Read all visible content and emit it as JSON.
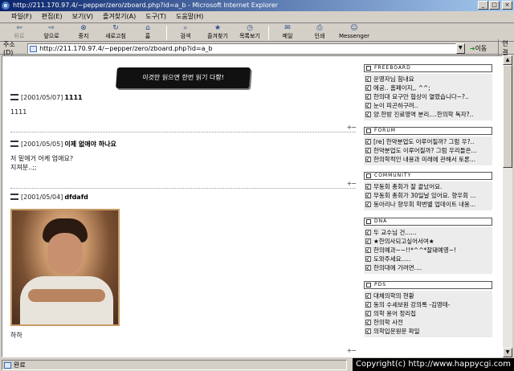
{
  "window": {
    "title": "http://211.170.97.4/~pepper/zero/zboard.php?id=a_b - Microsoft Internet Explorer"
  },
  "menu": [
    "파일(F)",
    "편집(E)",
    "보기(V)",
    "즐겨찾기(A)",
    "도구(T)",
    "도움말(H)"
  ],
  "toolbar": {
    "back": "뒤로",
    "forward": "앞으로",
    "stop": "중지",
    "refresh": "새로고침",
    "home": "홈",
    "search": "검색",
    "favorites": "즐겨찾기",
    "history": "목록보기",
    "mail": "메일",
    "print": "인쇄",
    "messenger": "Messenger"
  },
  "address": {
    "label": "주소(D)",
    "url": "http://211.170.97.4/~pepper/zero/zboard.php?id=a_b",
    "go": "이동",
    "links": "연결"
  },
  "page": {
    "banner": "이것만 읽으면 한번 읽기 다함!",
    "posts": [
      {
        "date": "[2001/05/07]",
        "title": "1111",
        "body": [
          "1111"
        ]
      },
      {
        "date": "[2001/05/05]",
        "title": "이제 없애야 하나요",
        "body": [
          "저 밑에거 어케 업애요?",
          "지져분..;;"
        ]
      },
      {
        "date": "[2001/05/04]",
        "title": "dfdafd",
        "body": [
          "하하"
        ]
      }
    ],
    "plusminus": "+−"
  },
  "sidebar": {
    "boxes": [
      {
        "title": "FREEBOARD",
        "items": [
          "운영자님 힘내요",
          "에공.. 홈페이지,, ^^;",
          "한의대 요구안 협상이 열렸습니다~?..",
          "눈이 피곤하구려..",
          "양.한방 진료영역 분리....한의학 독자?.."
        ]
      },
      {
        "title": "FORUM",
        "items": [
          "[re] 한약분업도 이루어질까? 그럼 우?..",
          "한약분업도 이루어질까? 그럼 우리들은...",
          "한의학적인 내용과 미래에 관해서 토론..."
        ]
      },
      {
        "title": "COMMUNITY",
        "items": [
          "무동회 총회가 잘 끝났어요.",
          "무동회 총회가 30일날 있어요. 향우회 ...",
          "동아리나 향우회 학번별 업데이트 내용..."
        ]
      },
      {
        "title": "DNA",
        "items": [
          "두 교수님 건......",
          "★한의사되고싶어서여★",
          "한의예과~~!!*^^*잘돼예영~!",
          "도와주세요.....",
          "한의대에 가려면...."
        ]
      },
      {
        "title": "PDS",
        "items": [
          "대체의학의 현황",
          "동의 수세보원 강의록 -김영태-",
          "의학 용어 정리집",
          "한의학 사전",
          "의학입문원문 파일"
        ]
      }
    ]
  },
  "status": {
    "text": "완료"
  },
  "watermark": "Copyright(c) http://www.happycgi.com"
}
